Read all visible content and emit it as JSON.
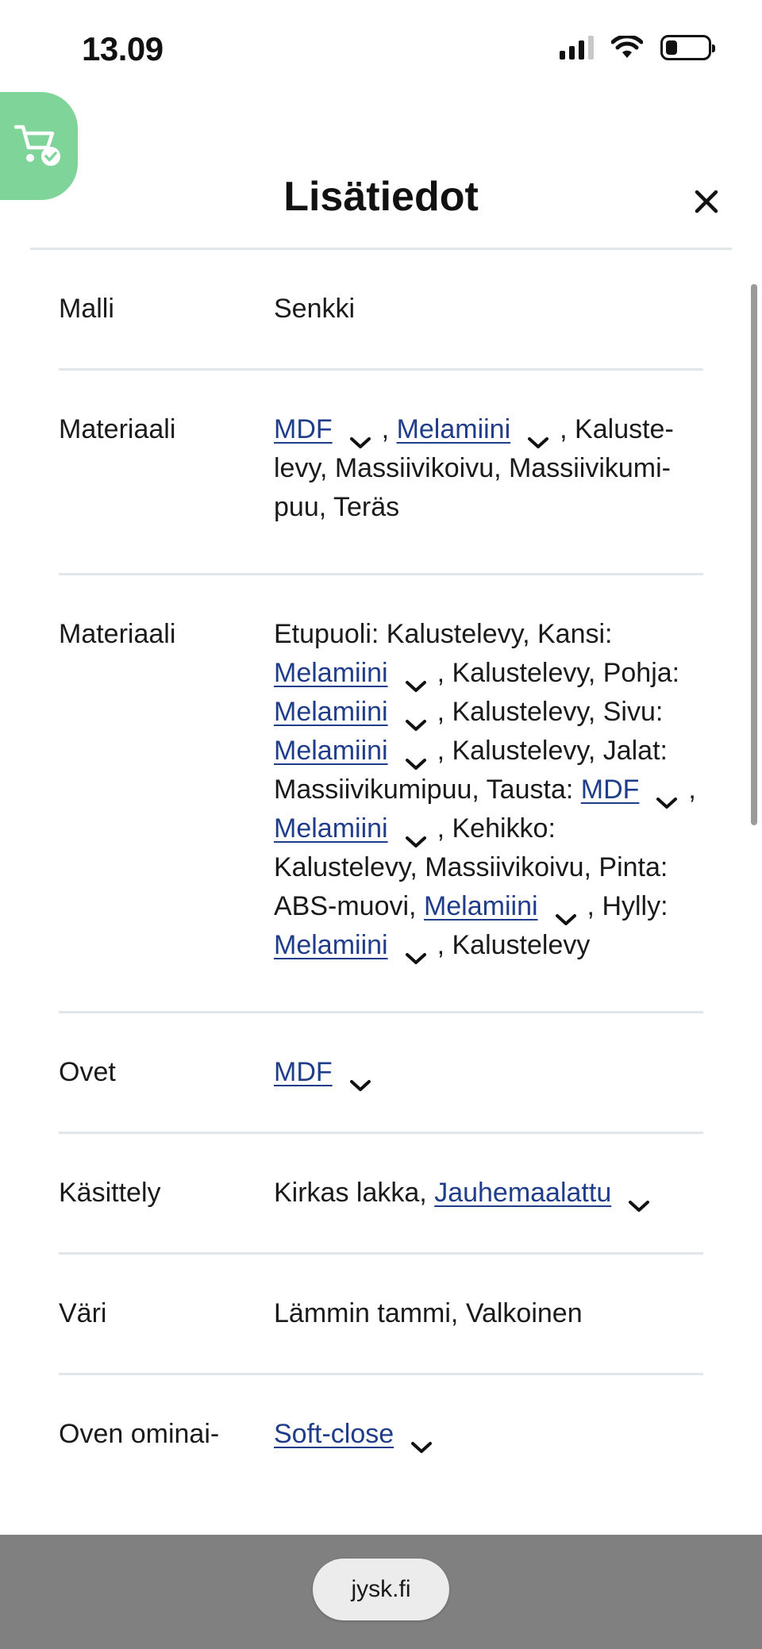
{
  "status_bar": {
    "time": "13.09",
    "battery_level": 0.28
  },
  "modal": {
    "title": "Lisätiedot",
    "close_icon": "close-icon"
  },
  "cart": {
    "icon": "cart-check-icon",
    "color": "#7fd49a"
  },
  "colors": {
    "link": "#1f3d8a",
    "divider": "#e3e6e8",
    "bottom_bar": "#808080"
  },
  "specs": [
    {
      "label": "Malli",
      "value": [
        {
          "t": "Senkki"
        }
      ]
    },
    {
      "label": "Materiaali",
      "value": [
        {
          "link": "MDF"
        },
        {
          "t": ", "
        },
        {
          "link": "Melamiini"
        },
        {
          "t": ", Kaluste-levy, Massiivikoivu, Massiivikumi-puu, Teräs"
        }
      ]
    },
    {
      "label": "Materiaali",
      "value": [
        {
          "t": "Etupuoli: Kalustelevy, Kansi: "
        },
        {
          "link": "Melamiini"
        },
        {
          "t": ", Kalustelevy, Pohja: "
        },
        {
          "link": "Melamiini"
        },
        {
          "t": ", Kalustelevy, Sivu: "
        },
        {
          "link": "Melamiini"
        },
        {
          "t": ", Kalustelevy, Jalat: Massiivikumipuu, Tausta: "
        },
        {
          "link": "MDF"
        },
        {
          "t": ", "
        },
        {
          "link": "Melamiini"
        },
        {
          "t": ", Kehikko: Kalustelevy, Massiivikoivu, Pinta: ABS-muovi, "
        },
        {
          "link": "Melamiini"
        },
        {
          "t": ", Hylly: "
        },
        {
          "link": "Melamiini"
        },
        {
          "t": ", Kalustelevy"
        }
      ]
    },
    {
      "label": "Ovet",
      "value": [
        {
          "link": "MDF"
        }
      ]
    },
    {
      "label": "Käsittely",
      "value": [
        {
          "t": "Kirkas lakka, "
        },
        {
          "link": "Jauhemaalattu"
        }
      ]
    },
    {
      "label": "Väri",
      "value": [
        {
          "t": "Lämmin tammi, Valkoinen"
        }
      ]
    },
    {
      "label": "Oven ominai-",
      "value": [
        {
          "link": "Soft-close"
        }
      ]
    }
  ],
  "browser": {
    "url": "jysk.fi"
  }
}
